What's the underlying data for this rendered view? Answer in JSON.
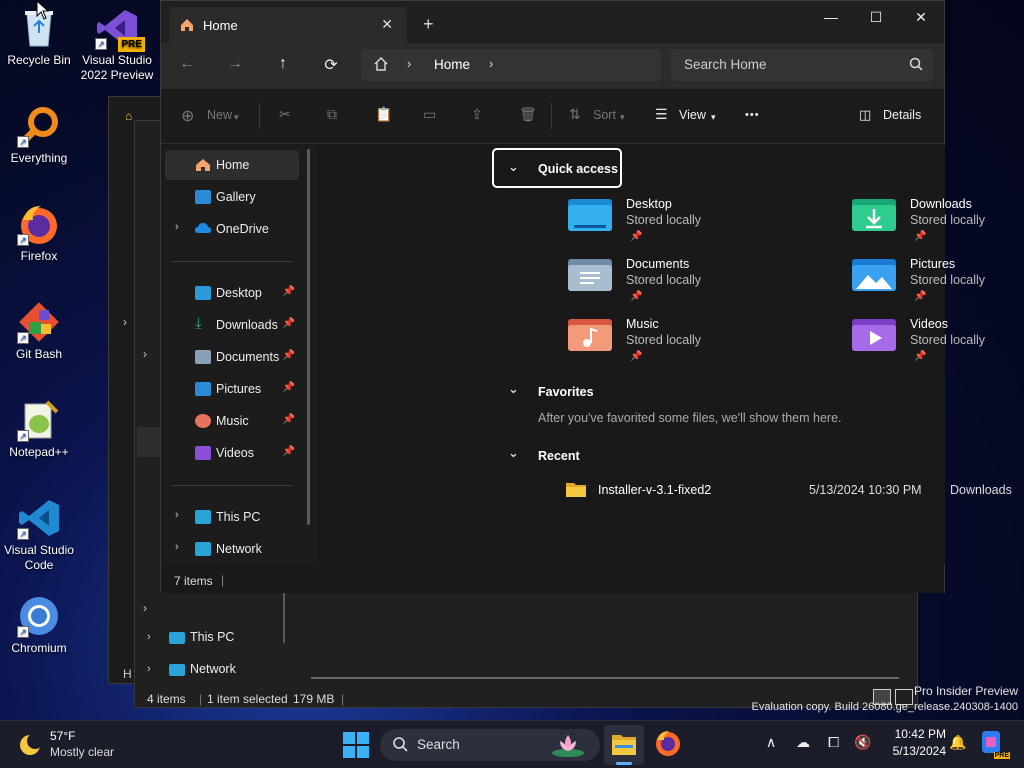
{
  "desktop": {
    "icons": [
      {
        "label": "Recycle Bin"
      },
      {
        "label": "Visual Studio 2022 Preview",
        "badge": "PRE"
      },
      {
        "label": "Everything"
      },
      {
        "label": "Firefox"
      },
      {
        "label": "Git Bash"
      },
      {
        "label": "Notepad++"
      },
      {
        "label": "Visual Studio Code"
      },
      {
        "label": "Chromium"
      }
    ],
    "watermark": {
      "line1": "Pro Insider Preview",
      "line2": "Evaluation copy. Build 26080.ge_release.240308-1400"
    }
  },
  "back_window": {
    "nav_items": [
      {
        "label": "This PC"
      },
      {
        "label": "Network"
      }
    ],
    "status": {
      "items": "4 items",
      "selected": "1 item selected",
      "size": "179 MB"
    },
    "partial_tab": "H"
  },
  "window": {
    "tab_label": "Home",
    "close_tab": "✕",
    "new_tab": "+",
    "controls": {
      "minimize": "—",
      "maximize": "☐",
      "close": "✕"
    },
    "breadcrumb": {
      "item": "Home"
    },
    "search_placeholder": "Search Home",
    "commands": {
      "new": "New",
      "sort": "Sort",
      "view": "View",
      "more": "•••",
      "details": "Details"
    },
    "nav": {
      "items": [
        {
          "label": "Home"
        },
        {
          "label": "Gallery"
        },
        {
          "label": "OneDrive"
        },
        {
          "label": "Desktop"
        },
        {
          "label": "Downloads"
        },
        {
          "label": "Documents"
        },
        {
          "label": "Pictures"
        },
        {
          "label": "Music"
        },
        {
          "label": "Videos"
        },
        {
          "label": "This PC"
        },
        {
          "label": "Network"
        }
      ]
    },
    "quick_access": {
      "title": "Quick access",
      "folders": [
        {
          "name": "Desktop",
          "sub": "Stored locally"
        },
        {
          "name": "Downloads",
          "sub": "Stored locally"
        },
        {
          "name": "Documents",
          "sub": "Stored locally"
        },
        {
          "name": "Pictures",
          "sub": "Stored locally"
        },
        {
          "name": "Music",
          "sub": "Stored locally"
        },
        {
          "name": "Videos",
          "sub": "Stored locally"
        }
      ]
    },
    "favorites": {
      "title": "Favorites",
      "empty_text": "After you've favorited some files, we'll show them here."
    },
    "recent": {
      "title": "Recent",
      "files": [
        {
          "name": "Installer-v-3.1-fixed2",
          "date": "5/13/2024 10:30 PM",
          "location": "Downloads"
        }
      ]
    },
    "status": "7 items"
  },
  "taskbar": {
    "weather": {
      "temp": "57°F",
      "desc": "Mostly clear"
    },
    "search_label": "Search",
    "clock": {
      "time": "10:42 PM",
      "date": "5/13/2024"
    },
    "copilot_badge": "PRE"
  },
  "colors": {
    "accent_blue": "#4aa3f0",
    "folder_yellow": "#f5c842",
    "window_bg": "#191919"
  }
}
